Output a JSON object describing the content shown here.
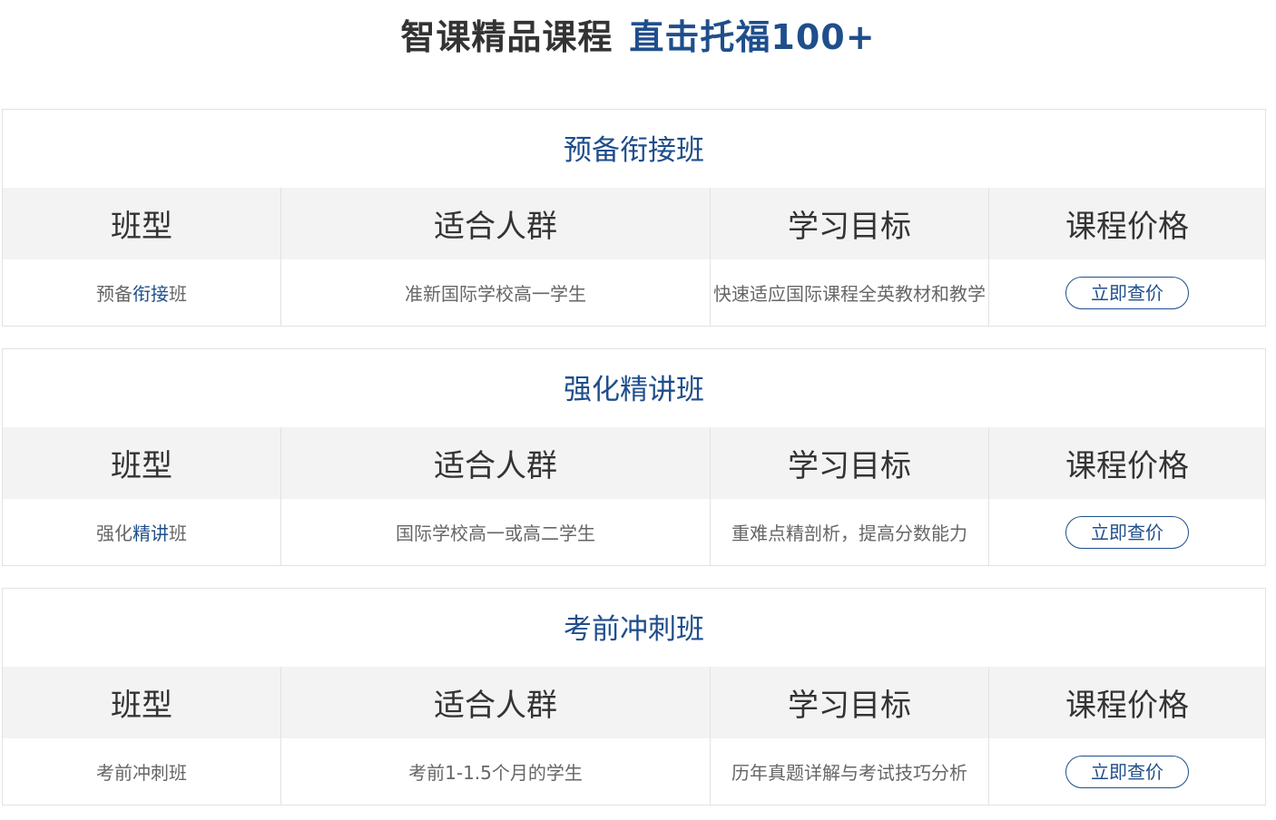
{
  "page": {
    "title_dark": "智课精品课程",
    "title_blue": "直击托福100+"
  },
  "colors": {
    "accent": "#1f4e8c",
    "header_bg": "#f3f3f3",
    "border": "#e2e2e2",
    "text_dark": "#333333",
    "text_muted": "#666666"
  },
  "courses": [
    {
      "title": "预备衔接班",
      "headers": [
        "班型",
        "适合人群",
        "学习目标",
        "课程价格"
      ],
      "row": {
        "name_prefix": "预备",
        "name_accent": "衔接",
        "name_suffix": "班",
        "audience": "准新国际学校高一学生",
        "goal": "快速适应国际课程全英教材和教学",
        "price_button": "立即查价"
      }
    },
    {
      "title": "强化精讲班",
      "headers": [
        "班型",
        "适合人群",
        "学习目标",
        "课程价格"
      ],
      "row": {
        "name_prefix": "强化",
        "name_accent": "精讲",
        "name_suffix": "班",
        "audience": "国际学校高一或高二学生",
        "goal": "重难点精剖析，提高分数能力",
        "price_button": "立即查价"
      }
    },
    {
      "title": "考前冲刺班",
      "headers": [
        "班型",
        "适合人群",
        "学习目标",
        "课程价格"
      ],
      "row": {
        "name_prefix": "考前冲刺班",
        "name_accent": "",
        "name_suffix": "",
        "audience": "考前1-1.5个月的学生",
        "goal": "历年真题详解与考试技巧分析",
        "price_button": "立即查价"
      }
    }
  ]
}
